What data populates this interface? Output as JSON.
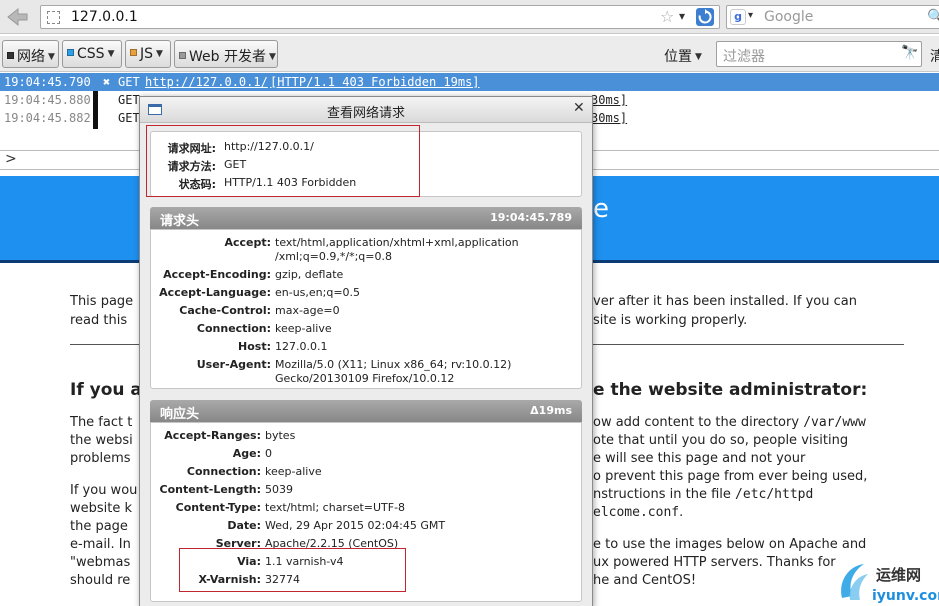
{
  "nav": {
    "url": "127.0.0.1",
    "search_placeholder": "Google"
  },
  "toolbar": {
    "categories": [
      {
        "label": "网络",
        "color": "#333333"
      },
      {
        "label": "CSS",
        "color": "#2e9ee6"
      },
      {
        "label": "JS",
        "color": "#e6a03c"
      },
      {
        "label": "Web 开发者",
        "color": "#9a9a9a"
      }
    ],
    "position_label": "位置",
    "filter_placeholder": "过滤器",
    "cut_label": "清"
  },
  "console": {
    "rows": [
      {
        "time": "19:04:45.790",
        "method": "GET",
        "url": "http://127.0.0.1/",
        "status": "[HTTP/1.1 403 Forbidden 19ms]"
      },
      {
        "time": "19:04:45.880",
        "method": "GET",
        "tail": "30ms]"
      },
      {
        "time": "19:04:45.882",
        "method": "GET",
        "tail": "30ms]"
      }
    ],
    "prompt": ">"
  },
  "page": {
    "banner_fragment": "e",
    "p1_line1_a": "This page",
    "p1_line1_b": "ver after it has been installed. If you can",
    "p1_line2_a": "read this",
    "p1_line2_b": "site is working properly.",
    "h_a": "If you a",
    "h_b": "e the website administrator:",
    "p2_l1_a": "The fact t",
    "p2_l1_b": "ow add content to the directory",
    "p2_l1_code": "/var/www",
    "p2_l2_a": "the websi",
    "p2_l2_b": "ote that until you do so, people visiting",
    "p2_l3_a": "problems",
    "p2_l3_b": "e will see this page and not your",
    "p3_l1_a": "If you wou",
    "p3_l1_b": "o prevent this page from ever being used,",
    "p3_l2_a": "website k",
    "p3_l2_b": "nstructions in the file",
    "p3_l2_code": "/etc/httpd",
    "p3_l3_a": "the page",
    "p3_l3_code": "elcome.conf",
    "p3_l3_end": ".",
    "p4_l1_a": "e-mail. In",
    "p4_l1_b": "e to use the images below on Apache and",
    "p4_l2_a": "\"webmas",
    "p4_l2_b": "ux powered HTTP servers. Thanks for",
    "p4_l3_a": "should re",
    "p4_l3_b": "he and CentOS!"
  },
  "dialog": {
    "title": "查看网络请求",
    "summary": {
      "url_label": "请求网址:",
      "url": "http://127.0.0.1/",
      "method_label": "请求方法:",
      "method": "GET",
      "status_label": "状态码:",
      "status": "HTTP/1.1 403 Forbidden"
    },
    "request": {
      "title": "请求头",
      "time": "19:04:45.789",
      "headers": [
        {
          "key": "Accept:",
          "value": "text/html,application/xhtml+xml,application",
          "value2": "/xml;q=0.9,*/*;q=0.8"
        },
        {
          "key": "Accept-Encoding:",
          "value": "gzip, deflate"
        },
        {
          "key": "Accept-Language:",
          "value": "en-us,en;q=0.5"
        },
        {
          "key": "Cache-Control:",
          "value": "max-age=0"
        },
        {
          "key": "Connection:",
          "value": "keep-alive"
        },
        {
          "key": "Host:",
          "value": "127.0.0.1"
        },
        {
          "key": "User-Agent:",
          "value": "Mozilla/5.0 (X11; Linux x86_64; rv:10.0.12)",
          "value2": "Gecko/20130109 Firefox/10.0.12"
        }
      ]
    },
    "response": {
      "title": "响应头",
      "delta": "Δ19ms",
      "headers": [
        {
          "key": "Accept-Ranges:",
          "value": "bytes"
        },
        {
          "key": "Age:",
          "value": "0"
        },
        {
          "key": "Connection:",
          "value": "keep-alive"
        },
        {
          "key": "Content-Length:",
          "value": "5039"
        },
        {
          "key": "Content-Type:",
          "value": "text/html; charset=UTF-8"
        },
        {
          "key": "Date:",
          "value": "Wed, 29 Apr 2015 02:04:45 GMT"
        },
        {
          "key": "Server:",
          "value": "Apache/2.2.15 (CentOS)"
        },
        {
          "key": "Via:",
          "value": "1.1 varnish-v4"
        },
        {
          "key": "X-Varnish:",
          "value": "32774"
        }
      ]
    }
  },
  "watermark": {
    "cn": "运维网",
    "en": "iyunv.com"
  }
}
